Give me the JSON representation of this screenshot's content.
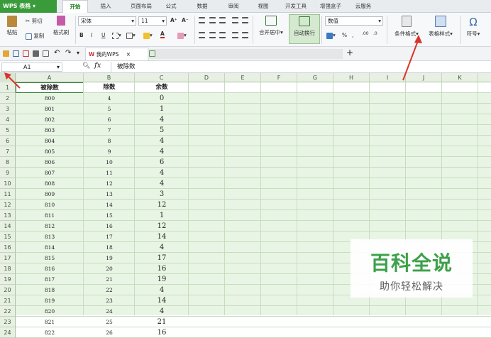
{
  "app": {
    "name": "WPS 表格"
  },
  "menu_tabs": [
    "开始",
    "插入",
    "页面布局",
    "公式",
    "数据",
    "审阅",
    "视图",
    "开发工具",
    "增强盒子",
    "云服务"
  ],
  "active_tab": "开始",
  "ribbon": {
    "paste": "粘贴",
    "cut": "剪切",
    "copy": "复制",
    "format_painter": "格式刷",
    "font_name": "宋体",
    "font_size": "11",
    "merge_center": "合并居中",
    "wrap_text": "自动换行",
    "number_format": "数值",
    "conditional_format": "条件格式",
    "table_style": "表格样式",
    "symbol": "符号",
    "bold": "B",
    "italic": "I",
    "underline": "U",
    "percent": "%",
    "grow_font": "A⁺",
    "shrink_font": "A⁻"
  },
  "doc_tabs": {
    "my_wps": "我的WPS",
    "close": "×",
    "new_tab": "+"
  },
  "formula_bar": {
    "cell_ref": "A1",
    "fx": "fx",
    "content": "被除数"
  },
  "columns": [
    "A",
    "B",
    "C",
    "D",
    "E",
    "F",
    "G",
    "H",
    "I",
    "J",
    "K"
  ],
  "headers": [
    "被除数",
    "除数",
    "余数"
  ],
  "rows": [
    {
      "n": "2",
      "a": "800",
      "b": "4",
      "c": "0"
    },
    {
      "n": "3",
      "a": "801",
      "b": "5",
      "c": "1"
    },
    {
      "n": "4",
      "a": "802",
      "b": "6",
      "c": "4"
    },
    {
      "n": "5",
      "a": "803",
      "b": "7",
      "c": "5"
    },
    {
      "n": "6",
      "a": "804",
      "b": "8",
      "c": "4"
    },
    {
      "n": "7",
      "a": "805",
      "b": "9",
      "c": "4"
    },
    {
      "n": "8",
      "a": "806",
      "b": "10",
      "c": "6"
    },
    {
      "n": "9",
      "a": "807",
      "b": "11",
      "c": "4"
    },
    {
      "n": "10",
      "a": "808",
      "b": "12",
      "c": "4"
    },
    {
      "n": "11",
      "a": "809",
      "b": "13",
      "c": "3"
    },
    {
      "n": "12",
      "a": "810",
      "b": "14",
      "c": "12"
    },
    {
      "n": "13",
      "a": "811",
      "b": "15",
      "c": "1"
    },
    {
      "n": "14",
      "a": "812",
      "b": "16",
      "c": "12"
    },
    {
      "n": "15",
      "a": "813",
      "b": "17",
      "c": "14"
    },
    {
      "n": "16",
      "a": "814",
      "b": "18",
      "c": "4"
    },
    {
      "n": "17",
      "a": "815",
      "b": "19",
      "c": "17"
    },
    {
      "n": "18",
      "a": "816",
      "b": "20",
      "c": "16"
    },
    {
      "n": "19",
      "a": "817",
      "b": "21",
      "c": "19"
    },
    {
      "n": "20",
      "a": "818",
      "b": "22",
      "c": "4"
    },
    {
      "n": "21",
      "a": "819",
      "b": "23",
      "c": "14"
    },
    {
      "n": "22",
      "a": "820",
      "b": "24",
      "c": "4"
    },
    {
      "n": "23",
      "a": "821",
      "b": "25",
      "c": "21"
    },
    {
      "n": "24",
      "a": "822",
      "b": "26",
      "c": "16"
    }
  ],
  "watermark": {
    "title": "百科全说",
    "subtitle": "助你轻松解决"
  },
  "colors": {
    "brand_green": "#3a9b3a",
    "grid_bg": "#e9f5e4",
    "arrow_red": "#d9342b"
  }
}
